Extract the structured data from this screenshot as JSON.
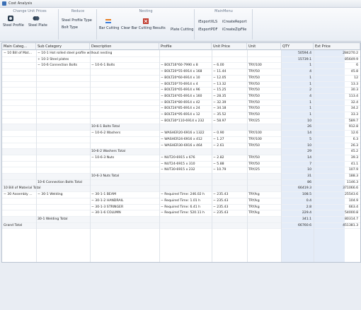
{
  "window": {
    "title": "Cost Analysis"
  },
  "ribbon": {
    "groups": [
      {
        "title": "Change Unit Prices",
        "buttons": [
          "Steel Profile",
          "Steel Plate"
        ]
      },
      {
        "title": "Reduce",
        "buttons": [
          "Steel Profile Type",
          "Bolt  Type"
        ]
      },
      {
        "title": "Nesting",
        "buttons": [
          "Bar Cutting",
          "Clear Bar Cutting Results",
          "Plate Cutting"
        ]
      },
      {
        "title": "MainMenu",
        "buttons": [
          "iExportXLS",
          "iCreateReport",
          "iExportPDF",
          "iCreateZipFile"
        ]
      }
    ]
  },
  "grid": {
    "columns": [
      "Main Categ...",
      "Sub Category",
      "Description",
      "Profile",
      "Unit Price",
      "Unit",
      "QTY",
      "Ext Price"
    ],
    "rows": [
      {
        "main": "− 10  Bill of Mat...",
        "sub": "− 10-1  Hot rolled steel profile without nesting",
        "desc": "",
        "profile": "",
        "price": "",
        "unit": "",
        "qty": "50594.4",
        "ext": "284270.2"
      },
      {
        "main": "",
        "sub": "+ 10-3  Steel plates",
        "desc": "",
        "profile": "",
        "price": "",
        "unit": "",
        "qty": "15739.1",
        "ext": "85649.9"
      },
      {
        "main": "",
        "sub": "− 10-6  Connection Bolts",
        "desc": "− 10-6-1  Bolts",
        "profile": "− BOLT16*60-7990 x 8",
        "price": "− 6.00",
        "unit": "TRY/100",
        "qty": "1",
        "ext": "6"
      },
      {
        "main": "",
        "sub": "",
        "desc": "",
        "profile": "− BOLT20*55-6914 x 168",
        "price": "− 11.44",
        "unit": "TRY/50",
        "qty": "4",
        "ext": "45.8"
      },
      {
        "main": "",
        "sub": "",
        "desc": "",
        "profile": "− BOLT20*60-6914 x 10",
        "price": "− 12.05",
        "unit": "TRY/50",
        "qty": "1",
        "ext": "12"
      },
      {
        "main": "",
        "sub": "",
        "desc": "",
        "profile": "− BOLT20*70-6914 x 4",
        "price": "− 13.32",
        "unit": "TRY/50",
        "qty": "1",
        "ext": "13.3"
      },
      {
        "main": "",
        "sub": "",
        "desc": "",
        "profile": "− BOLT20*65-6914 x 96",
        "price": "− 15.25",
        "unit": "TRY/50",
        "qty": "2",
        "ext": "30.3"
      },
      {
        "main": "",
        "sub": "",
        "desc": "",
        "profile": "− BOLT24*65-6914 x 160",
        "price": "− 28.35",
        "unit": "TRY/50",
        "qty": "4",
        "ext": "113.4"
      },
      {
        "main": "",
        "sub": "",
        "desc": "",
        "profile": "− BOLT24*80-6914 x 42",
        "price": "− 32.39",
        "unit": "TRY/50",
        "qty": "1",
        "ext": "32.4"
      },
      {
        "main": "",
        "sub": "",
        "desc": "",
        "profile": "− BOLT24*85-6914 x 24",
        "price": "− 34.18",
        "unit": "TRY/50",
        "qty": "1",
        "ext": "34.2"
      },
      {
        "main": "",
        "sub": "",
        "desc": "",
        "profile": "− BOLT24*95-6914 x 12",
        "price": "− 35.52",
        "unit": "TRY/50",
        "qty": "1",
        "ext": "33.3"
      },
      {
        "main": "",
        "sub": "",
        "desc": "",
        "profile": "− BOLT30*110-6914 x 232",
        "price": "− 58.97",
        "unit": "TRY/25",
        "qty": "10",
        "ext": "589.7"
      },
      {
        "main": "",
        "sub": "",
        "desc": "10-6-1  Bolts Total",
        "profile": "",
        "price": "",
        "unit": "",
        "qty": "26",
        "ext": "912.8",
        "total": true
      },
      {
        "main": "",
        "sub": "",
        "desc": "− 10-6-2  Washers",
        "profile": "− WASHER20-6916 x 1322",
        "price": "− 0.90",
        "unit": "TRY/100",
        "qty": "14",
        "ext": "12.6"
      },
      {
        "main": "",
        "sub": "",
        "desc": "",
        "profile": "− WASHER24-6916 x 412",
        "price": "− 1.27",
        "unit": "TRY/100",
        "qty": "5",
        "ext": "6.3"
      },
      {
        "main": "",
        "sub": "",
        "desc": "",
        "profile": "− WASHER30-6916 x 464",
        "price": "− 2.61",
        "unit": "TRY/50",
        "qty": "10",
        "ext": "26.3"
      },
      {
        "main": "",
        "sub": "",
        "desc": "10-6-2  Washers Total",
        "profile": "",
        "price": "",
        "unit": "",
        "qty": "29",
        "ext": "45.2",
        "total": true
      },
      {
        "main": "",
        "sub": "",
        "desc": "− 10-6-3  Nuts",
        "profile": "− NUT20-6915 x 676",
        "price": "− 2.82",
        "unit": "TRY/50",
        "qty": "14",
        "ext": "39.3"
      },
      {
        "main": "",
        "sub": "",
        "desc": "",
        "profile": "− NUT24-6915 x 310",
        "price": "− 5.88",
        "unit": "TRY/50",
        "qty": "7",
        "ext": "41.1"
      },
      {
        "main": "",
        "sub": "",
        "desc": "",
        "profile": "− NUT30-6915 x 232",
        "price": "− 10.79",
        "unit": "TRY/25",
        "qty": "10",
        "ext": "107.9"
      },
      {
        "main": "",
        "sub": "",
        "desc": "10-6-3  Nuts Total",
        "profile": "",
        "price": "",
        "unit": "",
        "qty": "31",
        "ext": "188.3",
        "total": true
      },
      {
        "main": "",
        "sub": "10-6  Connection Bolts Total",
        "desc": "",
        "profile": "",
        "price": "",
        "unit": "",
        "qty": "86",
        "ext": "1146.3",
        "total": true
      },
      {
        "main": "10  Bill of Material Total",
        "sub": "",
        "desc": "",
        "profile": "",
        "price": "",
        "unit": "",
        "qty": "66419.3",
        "ext": "371066.6",
        "total": true
      },
      {
        "main": "− 30  Assembly ...",
        "sub": "− 30-1  Welding",
        "desc": "− 30-1-1  BEAM",
        "profile": "− Required Time: 246.02 h",
        "price": "− 235.43",
        "unit": "TRY/kg",
        "qty": "108.5",
        "ext": "25543.6"
      },
      {
        "main": "",
        "sub": "",
        "desc": "− 30-1-2  HANDRAIL",
        "profile": "− Required Time: 1.01 h",
        "price": "− 235.43",
        "unit": "TRY/kg",
        "qty": "0.4",
        "ext": "104.9"
      },
      {
        "main": "",
        "sub": "",
        "desc": "− 30-1-3  STRINGER",
        "profile": "− Required Time: 6.41 h",
        "price": "− 235.43",
        "unit": "TRY/kg",
        "qty": "2.8",
        "ext": "663.4"
      },
      {
        "main": "",
        "sub": "",
        "desc": "− 30-1-6  COLUMN",
        "profile": "− Required Time: 520.11 h",
        "price": "− 235.43",
        "unit": "TRY/kg",
        "qty": "229.4",
        "ext": "54000.8"
      },
      {
        "main": "",
        "sub": "30-1  Welding Total",
        "desc": "",
        "profile": "",
        "price": "",
        "unit": "",
        "qty": "341.1",
        "ext": "80314.7",
        "total": true
      },
      {
        "main": "Grand Total",
        "sub": "",
        "desc": "",
        "profile": "",
        "price": "",
        "unit": "",
        "qty": "66760.6",
        "ext": "451381.3",
        "total": true
      }
    ]
  }
}
